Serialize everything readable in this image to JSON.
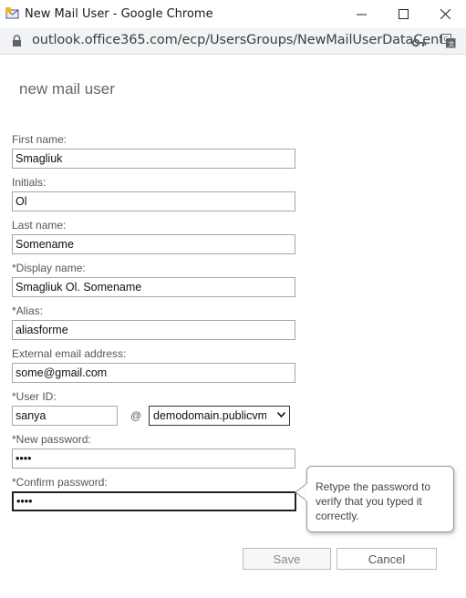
{
  "window": {
    "title": "New Mail User - Google Chrome",
    "url": "outlook.office365.com/ecp/UsersGroups/NewMailUserDataCent..."
  },
  "form": {
    "title": "new mail user",
    "first_name": {
      "label": "First name:",
      "value": "Smagliuk"
    },
    "initials": {
      "label": "Initials:",
      "value": "Ol"
    },
    "last_name": {
      "label": "Last name:",
      "value": "Somename"
    },
    "display_name": {
      "label": "*Display name:",
      "value": "Smagliuk Ol. Somename"
    },
    "alias": {
      "label": "*Alias:",
      "value": "aliasforme"
    },
    "external_email": {
      "label": "External email address:",
      "value": "some@gmail.com"
    },
    "user_id": {
      "label": "*User ID:",
      "value": "sanya",
      "at": "@",
      "domain": "demodomain.publicvm.c"
    },
    "new_password": {
      "label": "*New password:",
      "value": "••••"
    },
    "confirm_password": {
      "label": "*Confirm password:",
      "value": "••••"
    },
    "tooltip": "Retype the password to verify that you typed it correctly.",
    "save_label": "Save",
    "cancel_label": "Cancel"
  },
  "icons": {
    "app": "outlook-mail-icon",
    "lock": "lock-icon",
    "key": "key-icon",
    "translate": "translate-icon"
  }
}
